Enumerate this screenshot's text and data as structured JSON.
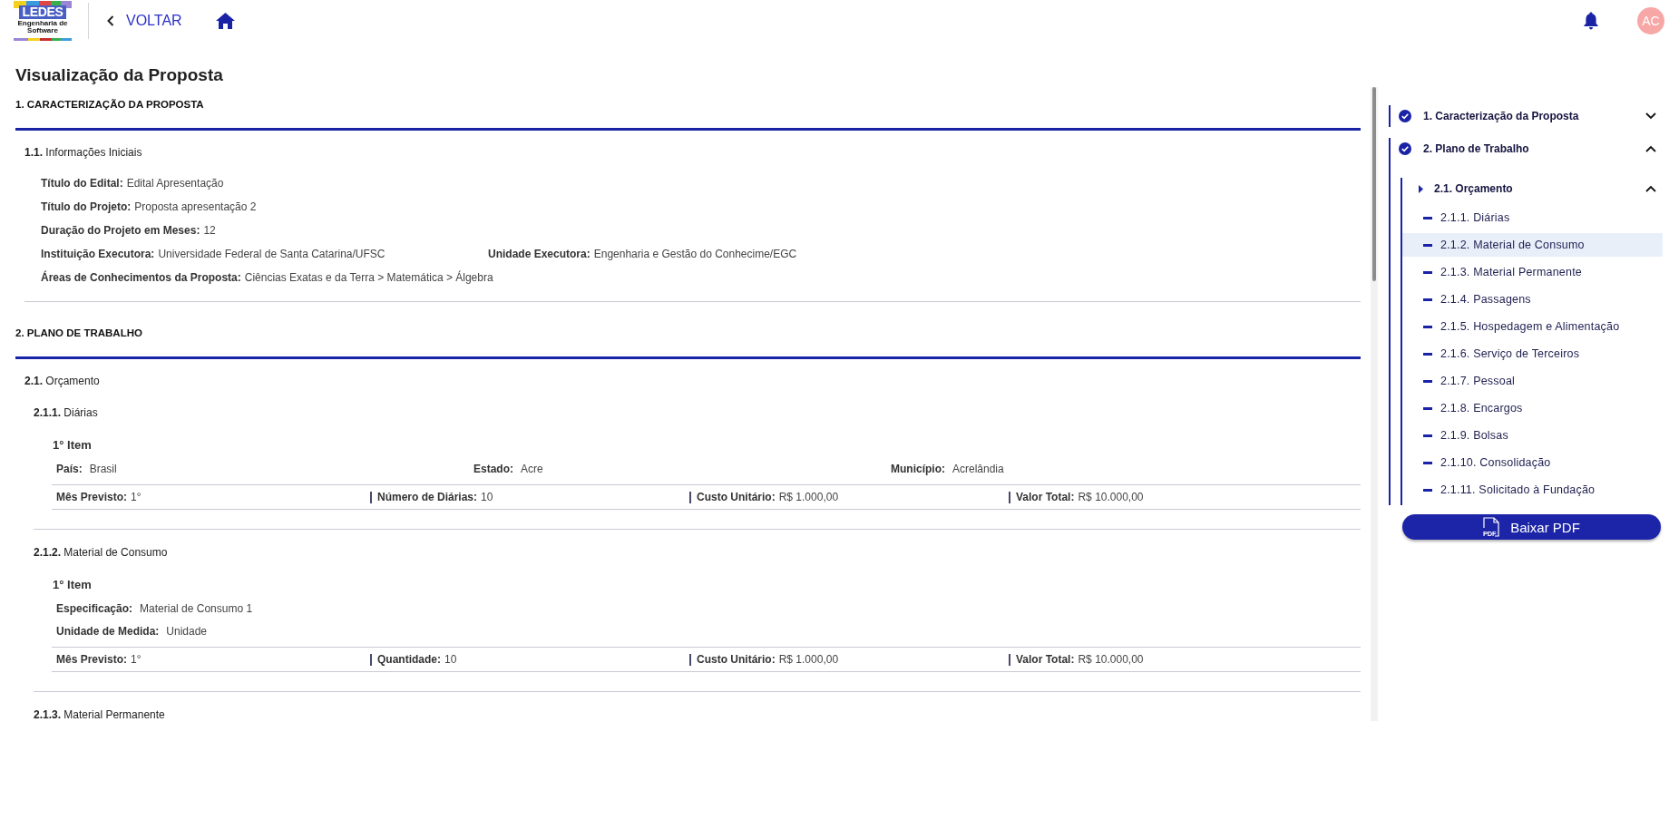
{
  "header": {
    "logo": {
      "wordmark": "LEDES",
      "subtitle": "Engenharia de Software"
    },
    "back_link": {
      "label": "VOLTAR"
    },
    "avatar": {
      "initials": "AC"
    }
  },
  "proposal": {
    "title": "Visualização da Proposta",
    "sections": [
      {
        "title": "1. CARACTERIZAÇÃO DA PROPOSTA",
        "subsections": [
          {
            "kind": "fields",
            "title": "**1.1.** Informações Iniciais",
            "rows": [
              [
                {
                  "label": "Título do Edital:",
                  "value": "Edital Apresentação"
                }
              ],
              [
                {
                  "label": "Título do Projeto:",
                  "value": "Proposta apresentação 2"
                }
              ],
              [
                {
                  "label": "Duração do Projeto em Meses:",
                  "value": "12"
                }
              ],
              [
                {
                  "label": "Instituição Executora:",
                  "value": "Universidade Federal de Santa Catarina/UFSC"
                },
                {
                  "label": "Unidade Executora:",
                  "value": "Engenharia e Gestão do Conhecime/EGC"
                }
              ],
              [
                {
                  "label": "Áreas de Conhecimentos da Proposta:",
                  "value": "Ciências Exatas e da Terra > Matemática > Álgebra"
                }
              ]
            ]
          }
        ]
      },
      {
        "title": "2. PLANO DE TRABALHO",
        "subsections": [
          {
            "kind": "groups",
            "title": "**2.1.** Orçamento",
            "groups": [
              {
                "title": "**2.1.1.** Diárias",
                "items": [
                  {
                    "title": "1° Item",
                    "details": [
                      [
                        {
                          "label": "País:",
                          "value": "Brasil"
                        },
                        {
                          "label": "Estado:",
                          "value": "Acre"
                        },
                        {
                          "label": "Município:",
                          "value": "Acrelândia"
                        }
                      ]
                    ],
                    "summary": [
                      {
                        "label": "Mês Previsto:",
                        "value": "1°"
                      },
                      {
                        "label": "Número de Diárias:",
                        "value": "10"
                      },
                      {
                        "label": "Custo Unitário:",
                        "value": "R$ 1.000,00"
                      },
                      {
                        "label": "Valor Total:",
                        "value": "R$ 10.000,00"
                      }
                    ]
                  }
                ]
              },
              {
                "title": "**2.1.2.** Material de Consumo",
                "items": [
                  {
                    "title": "1° Item",
                    "details": [
                      [
                        {
                          "label": "Especificação:",
                          "value": "Material de Consumo 1"
                        }
                      ],
                      [
                        {
                          "label": "Unidade de Medida:",
                          "value": "Unidade"
                        }
                      ]
                    ],
                    "summary": [
                      {
                        "label": "Mês Previsto:",
                        "value": "1°"
                      },
                      {
                        "label": "Quantidade:",
                        "value": "10"
                      },
                      {
                        "label": "Custo Unitário:",
                        "value": "R$ 1.000,00"
                      },
                      {
                        "label": "Valor Total:",
                        "value": "R$ 10.000,00"
                      }
                    ]
                  }
                ]
              },
              {
                "title": "**2.1.3.** Material Permanente"
              }
            ]
          }
        ]
      }
    ]
  },
  "nav": {
    "items": [
      {
        "label": "1. Caracterização da Proposta",
        "completed": true,
        "expanded": false,
        "selected": false
      },
      {
        "label": "2. Plano de Trabalho",
        "completed": true,
        "expanded": true,
        "selected": false,
        "children": [
          {
            "label": "2.1. Orçamento",
            "expanded": true,
            "selected": false,
            "children": [
              {
                "label": "2.1.1. Diárias",
                "selected": false
              },
              {
                "label": "2.1.2. Material de Consumo",
                "selected": true
              },
              {
                "label": "2.1.3. Material Permanente",
                "selected": false
              },
              {
                "label": "2.1.4. Passagens",
                "selected": false
              },
              {
                "label": "2.1.5. Hospedagem e Alimentação",
                "selected": false
              },
              {
                "label": "2.1.6. Serviço de Terceiros",
                "selected": false
              },
              {
                "label": "2.1.7. Pessoal",
                "selected": false
              },
              {
                "label": "2.1.8. Encargos",
                "selected": false
              },
              {
                "label": "2.1.9. Bolsas",
                "selected": false
              },
              {
                "label": "2.1.10. Consolidação",
                "selected": false
              },
              {
                "label": "2.1.11. Solicitado à Fundação",
                "selected": false
              }
            ]
          }
        ]
      }
    ],
    "download_button": {
      "label": "Baixar PDF",
      "icon_text": "PDF"
    }
  }
}
